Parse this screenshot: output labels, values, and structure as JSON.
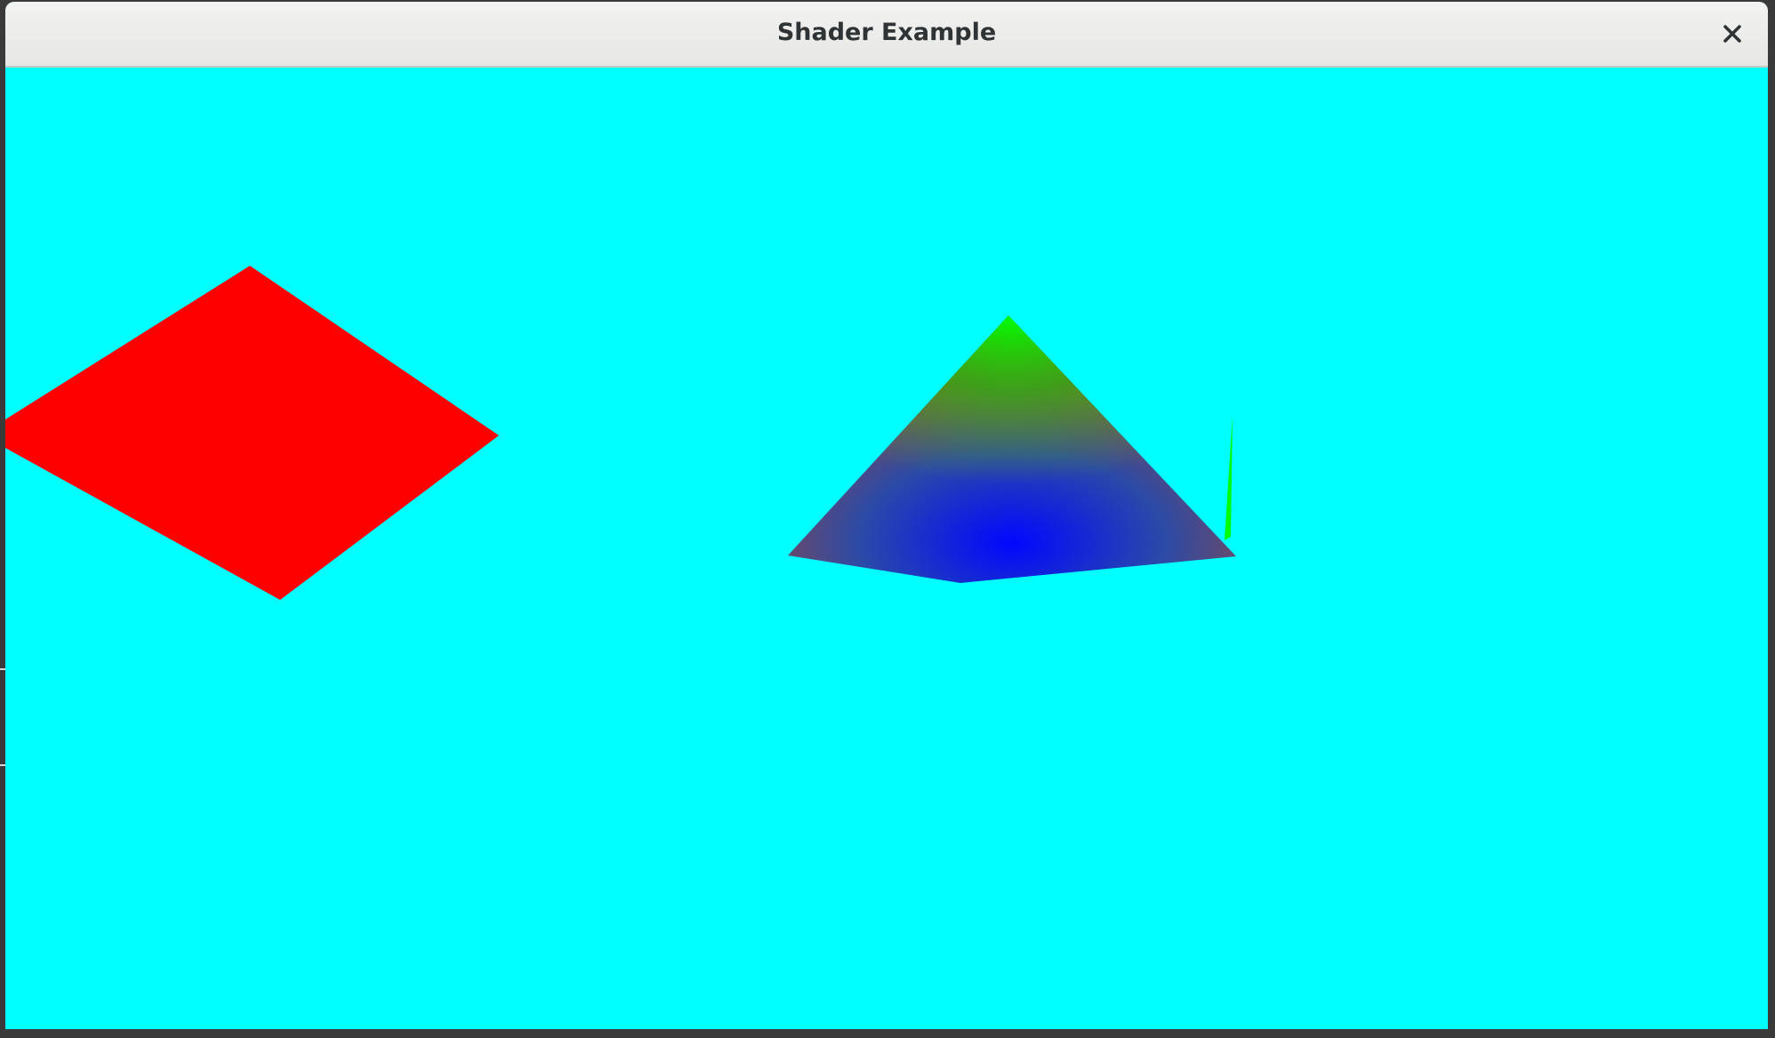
{
  "window": {
    "title": "Shader Example",
    "close_icon": "close-icon"
  },
  "scene": {
    "background_color": "#00ffff",
    "square": {
      "color": "#ff0000"
    },
    "pyramid": {
      "apex_color": "#00ff00",
      "center_color": "#0000ff",
      "base_edge_color": "#ff0000"
    },
    "sliver": {
      "color": "#00ff00"
    }
  }
}
